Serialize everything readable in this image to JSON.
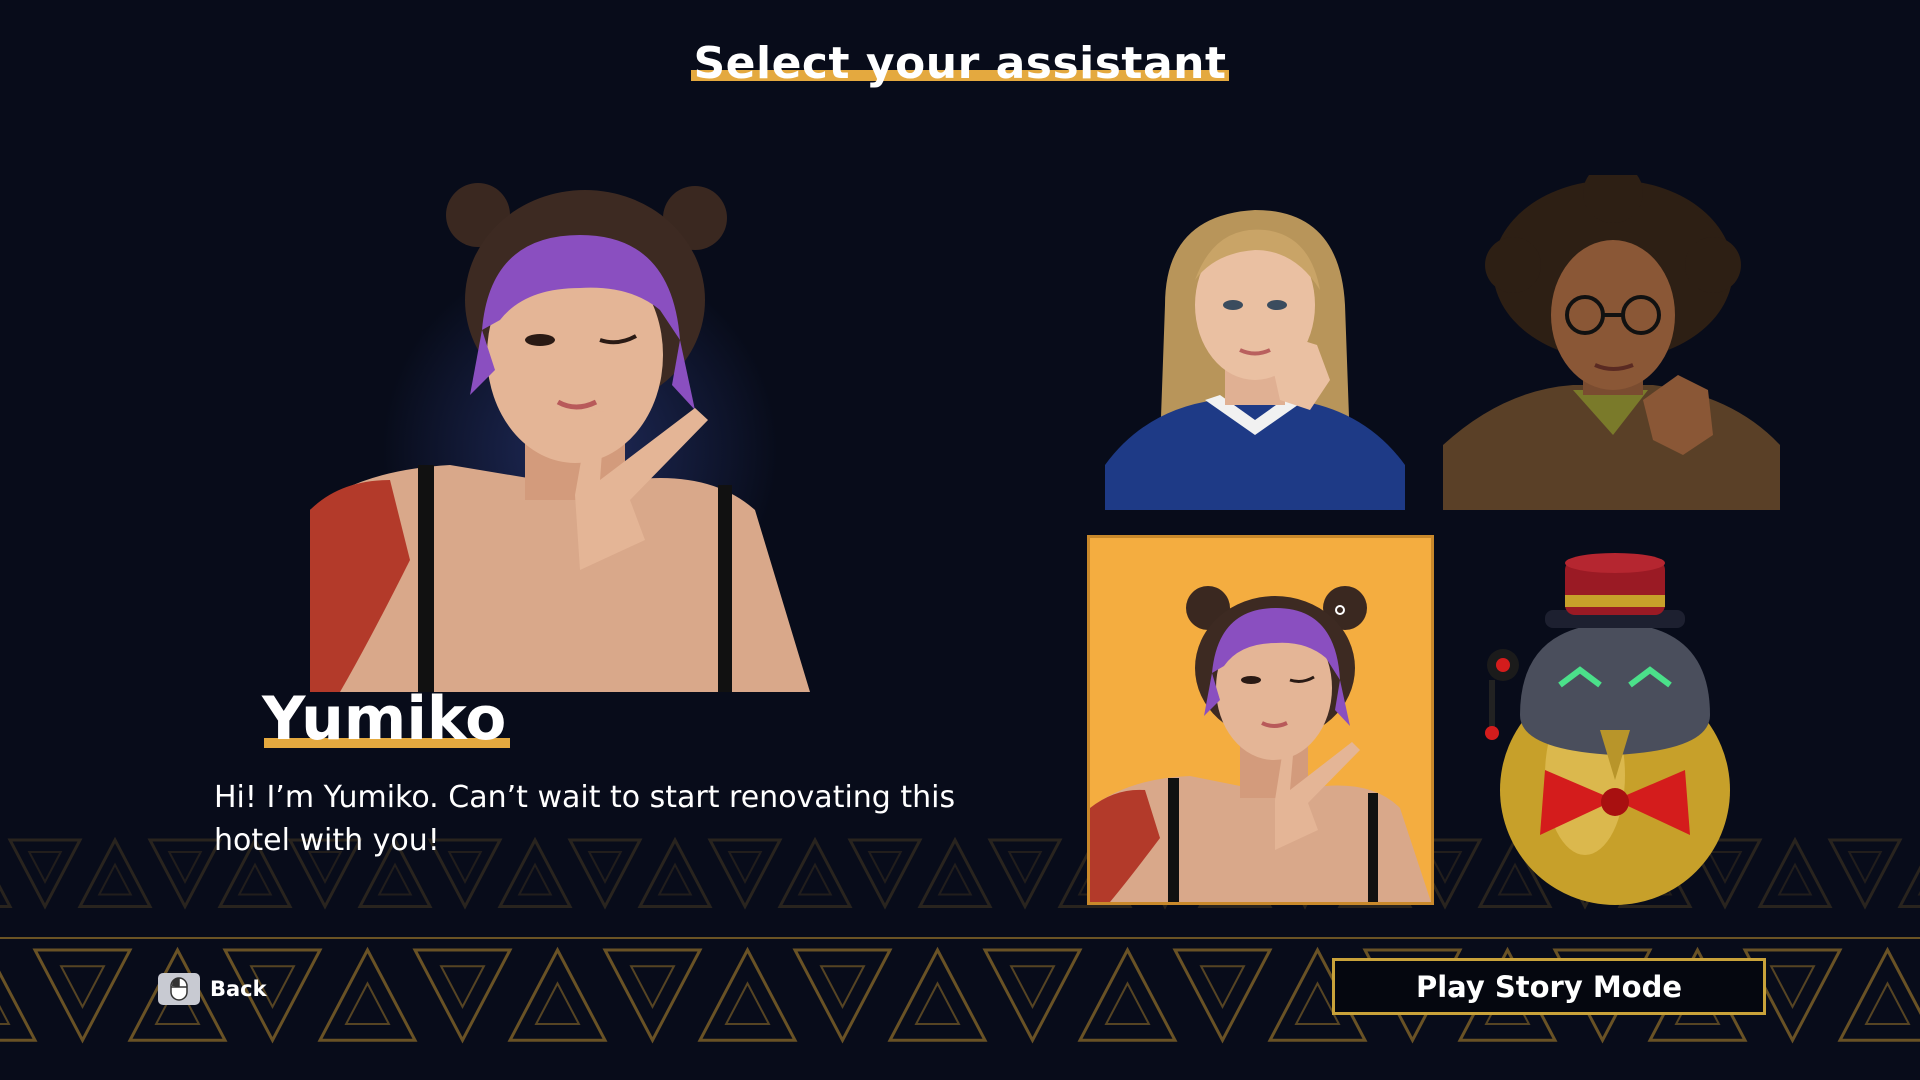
{
  "screen": {
    "title": "Select your assistant"
  },
  "selected": {
    "name": "Yumiko",
    "description": "Hi! I’m Yumiko. Can’t wait to start renovating this hotel with you!"
  },
  "assistants": [
    {
      "id": "blonde-woman",
      "selected": false
    },
    {
      "id": "curly-haired-man",
      "selected": false
    },
    {
      "id": "yumiko",
      "selected": true
    },
    {
      "id": "robot-bellhop",
      "selected": false
    }
  ],
  "footer": {
    "back_label": "Back",
    "back_icon": "mouse-icon",
    "play_label": "Play Story Mode"
  },
  "colors": {
    "background": "#080c1a",
    "accent": "#e4a93f",
    "selected_card_bg": "#f4ad40",
    "button_border": "#c9a23a"
  }
}
